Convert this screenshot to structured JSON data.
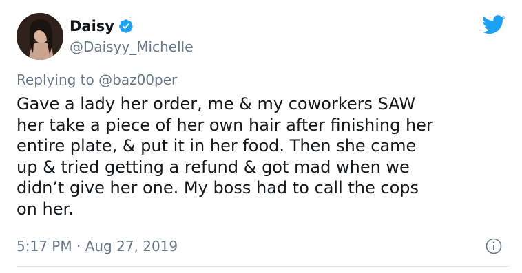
{
  "tweet": {
    "author": {
      "display_name": "Daisy",
      "handle": "@Daisyy_Michelle",
      "verified": true
    },
    "reply": {
      "prefix": "Replying to",
      "mention": "@baz00per"
    },
    "text": "Gave a lady her order, me & my coworkers SAW\nher take a piece of her own hair after finishing her\nentire plate, & put it in her food. Then she came\nup & tried getting a refund & got mad when we\ndidn’t give her one. My boss had to call the cops\non her.",
    "timestamp": "5:17 PM · Aug 27, 2019"
  },
  "icons": {
    "brand": "twitter-bird-icon",
    "verified": "verified-badge-icon",
    "info": "info-icon"
  },
  "colors": {
    "brand_blue": "#1da1f2",
    "text_primary": "#14171a",
    "text_secondary": "#657786",
    "divider": "#e1e8ed"
  }
}
